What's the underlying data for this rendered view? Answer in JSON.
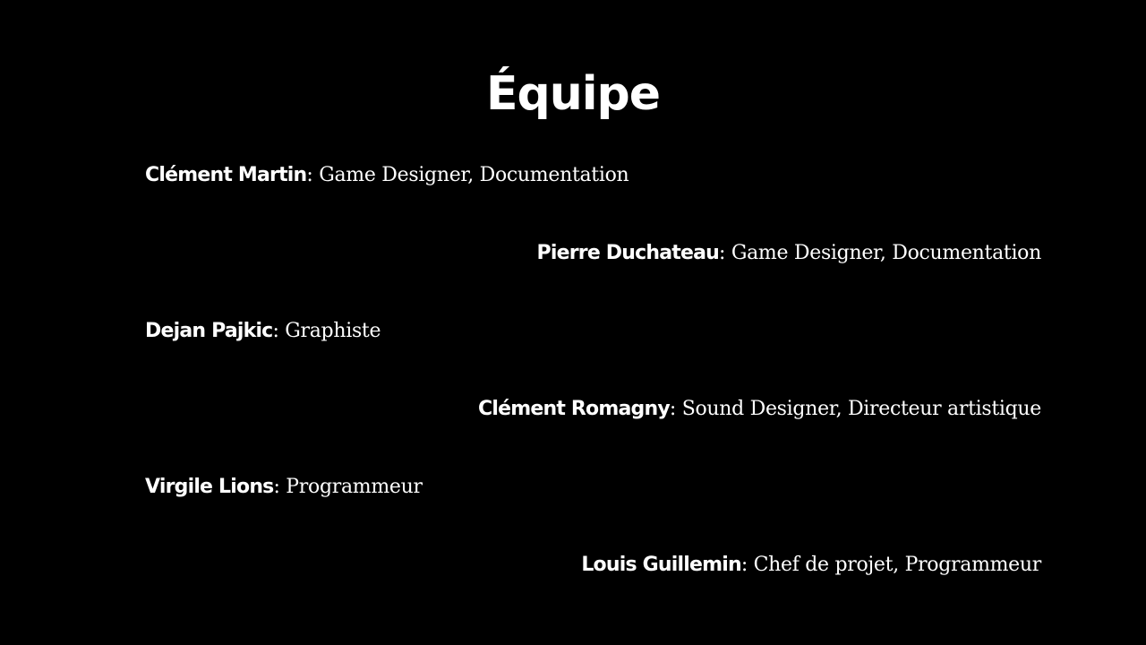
{
  "title": "Équipe",
  "members": [
    {
      "name": "Clément Martin",
      "role": ": Game Designer, Documentation"
    },
    {
      "name": "Pierre Duchateau",
      "role": ": Game Designer, Documentation"
    },
    {
      "name": "Dejan Pajkic",
      "role": ": Graphiste"
    },
    {
      "name": "Clément Romagny",
      "role": ": Sound Designer, Directeur artistique"
    },
    {
      "name": "Virgile Lions",
      "role": ": Programmeur"
    },
    {
      "name": "Louis Guillemin",
      "role": ": Chef de projet, Programmeur"
    }
  ]
}
